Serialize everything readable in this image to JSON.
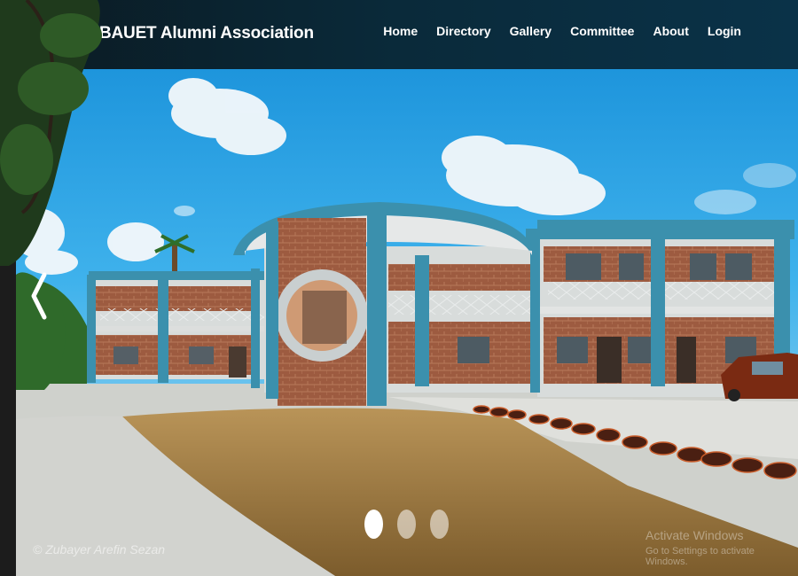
{
  "brand": {
    "title": "BAUET Alumni Association",
    "logo_icon": "university-crest-icon"
  },
  "nav": {
    "items": [
      {
        "label": "Home"
      },
      {
        "label": "Directory"
      },
      {
        "label": "Gallery"
      },
      {
        "label": "Committee"
      },
      {
        "label": "About"
      },
      {
        "label": "Login"
      }
    ]
  },
  "carousel": {
    "prev_icon": "chevron-left-icon",
    "slide_count": 3,
    "active_index": 0,
    "photo_credit": "© Zubayer Arefin Sezan"
  },
  "os_overlay": {
    "line1": "Activate Windows",
    "line2": "Go to Settings to activate Windows."
  },
  "colors": {
    "navbar": "#0a2a3a",
    "sky": "#2aa6e6",
    "pillar": "#3b90ad",
    "brick": "#9b5a3e",
    "lawn": "#9c7a3e"
  }
}
